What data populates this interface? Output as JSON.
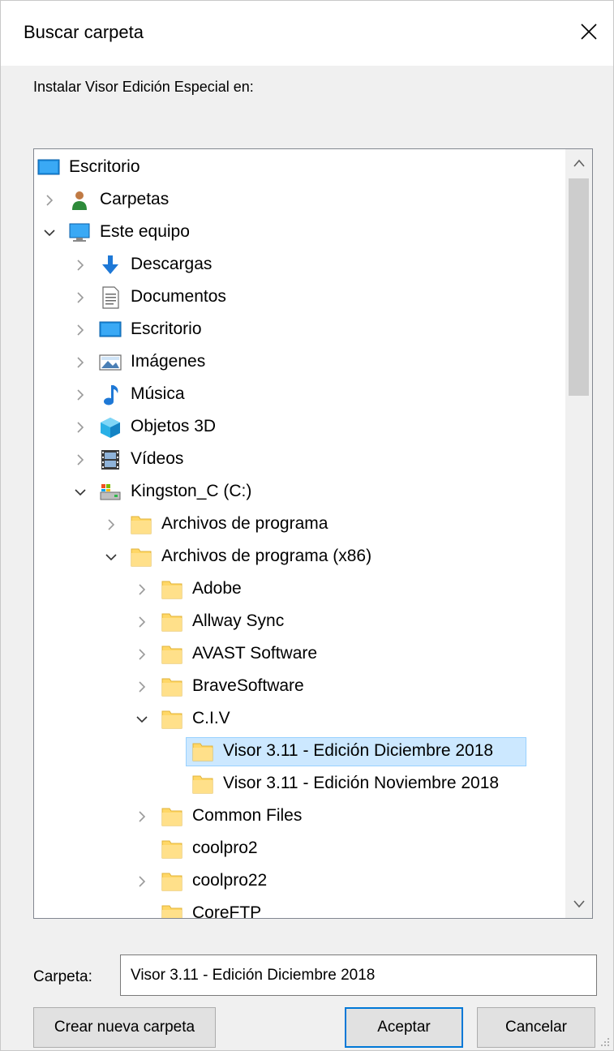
{
  "dialog": {
    "title": "Buscar carpeta",
    "instruction": "Instalar Visor Edición Especial en:"
  },
  "tree": {
    "items": [
      {
        "label": "Escritorio",
        "icon": "desktop-icon",
        "chevron": "none"
      },
      {
        "label": "Carpetas",
        "icon": "user-folder-icon",
        "chevron": "collapsed"
      },
      {
        "label": "Este equipo",
        "icon": "computer-icon",
        "chevron": "expanded"
      },
      {
        "label": "Descargas",
        "icon": "download-arrow-icon",
        "chevron": "collapsed"
      },
      {
        "label": "Documentos",
        "icon": "document-icon",
        "chevron": "collapsed"
      },
      {
        "label": "Escritorio",
        "icon": "desktop-icon",
        "chevron": "collapsed"
      },
      {
        "label": "Imágenes",
        "icon": "pictures-icon",
        "chevron": "collapsed"
      },
      {
        "label": "Música",
        "icon": "music-note-icon",
        "chevron": "collapsed"
      },
      {
        "label": "Objetos 3D",
        "icon": "cube-3d-icon",
        "chevron": "collapsed"
      },
      {
        "label": "Vídeos",
        "icon": "film-icon",
        "chevron": "collapsed"
      },
      {
        "label": "Kingston_C (C:)",
        "icon": "drive-icon",
        "chevron": "expanded"
      },
      {
        "label": "Archivos de programa",
        "icon": "folder-icon",
        "chevron": "collapsed"
      },
      {
        "label": "Archivos de programa (x86)",
        "icon": "folder-icon",
        "chevron": "expanded"
      },
      {
        "label": "Adobe",
        "icon": "folder-icon",
        "chevron": "collapsed"
      },
      {
        "label": "Allway Sync",
        "icon": "folder-icon",
        "chevron": "collapsed"
      },
      {
        "label": "AVAST Software",
        "icon": "folder-icon",
        "chevron": "collapsed"
      },
      {
        "label": "BraveSoftware",
        "icon": "folder-icon",
        "chevron": "collapsed"
      },
      {
        "label": "C.I.V",
        "icon": "folder-icon",
        "chevron": "expanded"
      },
      {
        "label": "Visor 3.11 - Edición Diciembre 2018",
        "icon": "folder-icon",
        "chevron": "none",
        "selected": true
      },
      {
        "label": "Visor 3.11 - Edición Noviembre 2018",
        "icon": "folder-icon",
        "chevron": "none"
      },
      {
        "label": "Common Files",
        "icon": "folder-icon",
        "chevron": "collapsed"
      },
      {
        "label": "coolpro2",
        "icon": "folder-icon",
        "chevron": "none"
      },
      {
        "label": "coolpro22",
        "icon": "folder-icon",
        "chevron": "collapsed"
      },
      {
        "label": "CoreFTP",
        "icon": "folder-icon",
        "chevron": "none"
      }
    ]
  },
  "folder_field": {
    "label": "Carpeta:",
    "value": "Visor 3.11 - Edición Diciembre 2018"
  },
  "buttons": {
    "new_folder": "Crear nueva carpeta",
    "ok": "Aceptar",
    "cancel": "Cancelar"
  },
  "colors": {
    "selection_bg": "#cce8ff",
    "default_button_border": "#0078d7",
    "folder_yellow": "#ffd766"
  }
}
